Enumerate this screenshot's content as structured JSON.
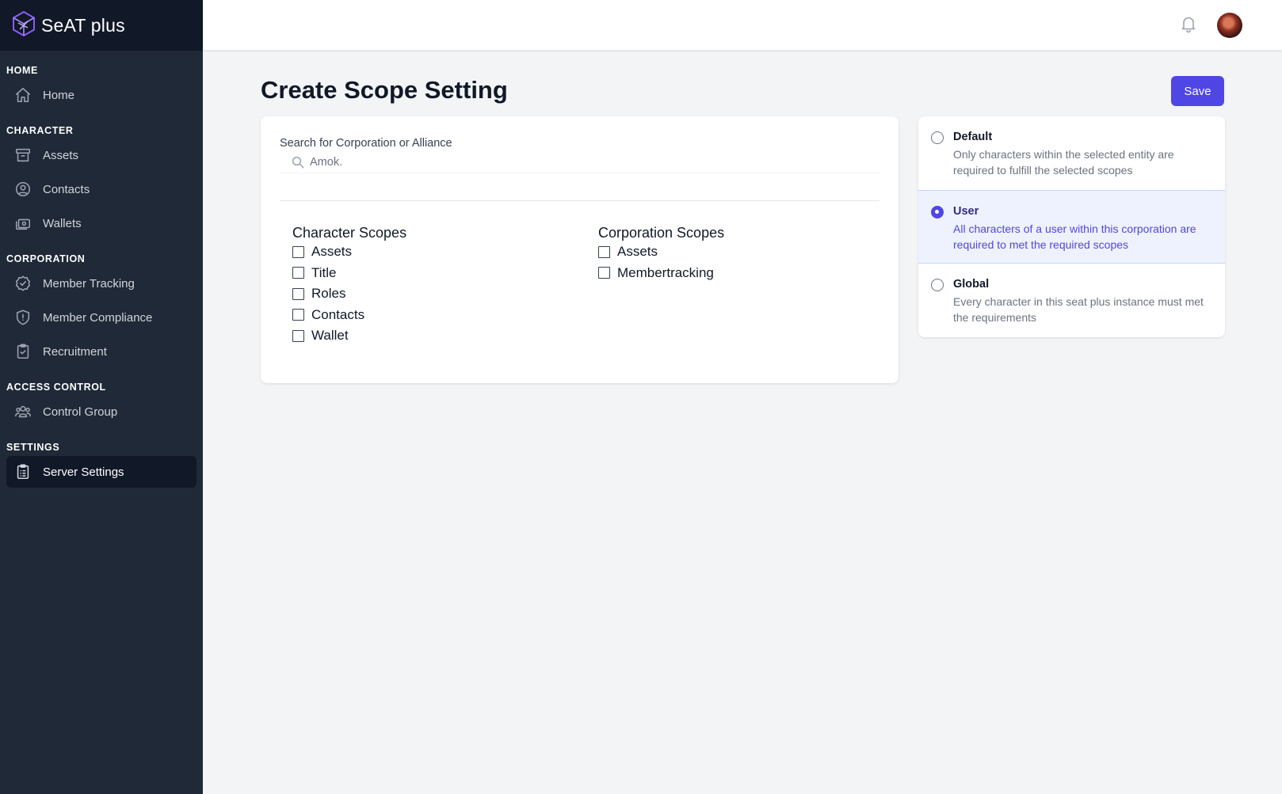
{
  "app": {
    "name": "SeAT plus"
  },
  "sidebar": {
    "sections": {
      "home": "HOME",
      "character": "CHARACTER",
      "corporation": "CORPORATION",
      "access_control": "ACCESS CONTROL",
      "settings": "SETTINGS"
    },
    "items": {
      "home": "Home",
      "assets": "Assets",
      "contacts": "Contacts",
      "wallets": "Wallets",
      "member_tracking": "Member Tracking",
      "member_compliance": "Member Compliance",
      "recruitment": "Recruitment",
      "control_group": "Control Group",
      "server_settings": "Server Settings"
    },
    "active_item": "Server Settings"
  },
  "header": {
    "notification_icon": "bell-icon",
    "avatar": "user-avatar"
  },
  "page": {
    "title": "Create Scope Setting",
    "save_label": "Save"
  },
  "search": {
    "label": "Search for Corporation or Alliance",
    "placeholder": "Amok."
  },
  "character_scopes": {
    "heading": "Character Scopes",
    "items": [
      "Assets",
      "Title",
      "Roles",
      "Contacts",
      "Wallet"
    ],
    "checked": [
      false,
      false,
      false,
      false,
      false
    ]
  },
  "corporation_scopes": {
    "heading": "Corporation Scopes",
    "items": [
      "Assets",
      "Membertracking"
    ],
    "checked": [
      false,
      false
    ]
  },
  "options": [
    {
      "title": "Default",
      "description": "Only characters within the selected entity are required to fulfill the selected scopes",
      "selected": false
    },
    {
      "title": "User",
      "description": "All characters of a user within this corporation are required to met the required scopes",
      "selected": true
    },
    {
      "title": "Global",
      "description": "Every character in this seat plus instance must met the requirements",
      "selected": false
    }
  ],
  "colors": {
    "accent": "#4f46e5",
    "sidebar_bg": "#1f2937",
    "sidebar_brand_bg": "#111827",
    "selected_option_bg": "#eef2ff"
  }
}
